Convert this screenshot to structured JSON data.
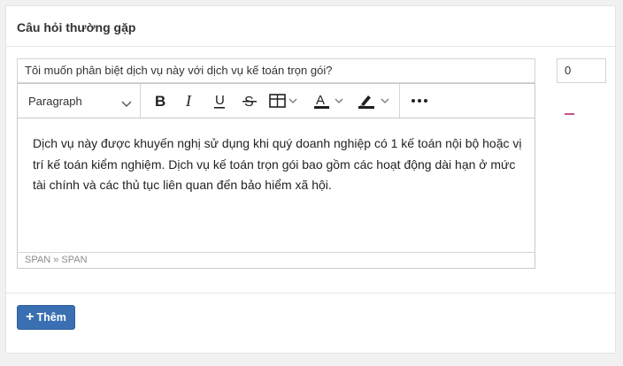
{
  "panel": {
    "title": "Câu hỏi thường gặp"
  },
  "faq": {
    "question": "Tôi muốn phân biệt dịch vụ này với dịch vụ kế toán trọn gói?",
    "order": "0",
    "answer": "Dịch vụ này được khuyến nghị sử dụng khi quý doanh nghiệp có 1 kế toán nội bộ hoặc vị trí kế toán kiểm nghiệm. Dịch vụ kế toán trọn gói bao gồm các hoạt động dài hạn ở mức tài chính và các thủ tục liên quan đến bảo hiểm xã hội."
  },
  "editor": {
    "block_format": "Paragraph",
    "element_path": "SPAN » SPAN",
    "icons": {
      "dropdown": "chevron-down-icon",
      "bold": "bold-icon",
      "italic": "italic-icon",
      "underline": "underline-icon",
      "strike": "strikethrough-icon",
      "table": "table-icon",
      "text_color": "text-color-icon",
      "highlight": "highlight-icon",
      "more": "more-icon"
    },
    "text_color_swatch": "#1f1f1f",
    "highlight_swatch": "#1f1f1f"
  },
  "actions": {
    "add_label": "Thêm",
    "add_icon": "plus-icon",
    "remove_icon": "minus-icon"
  },
  "colors": {
    "primary": "#3a70b3",
    "remove": "#c2508a"
  }
}
